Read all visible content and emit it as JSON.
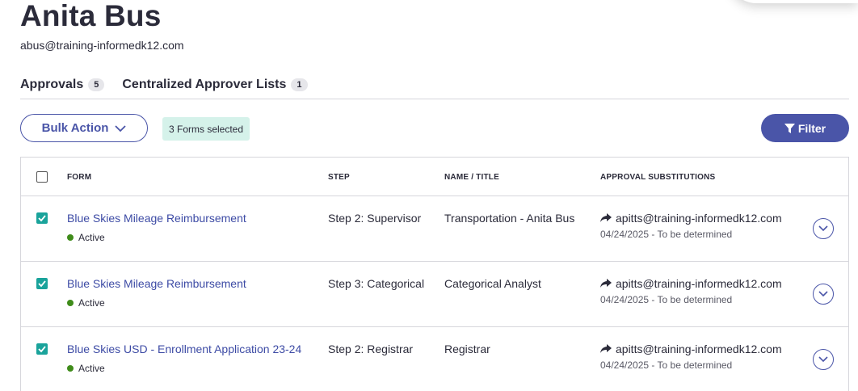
{
  "header": {
    "title": "Anita Bus",
    "email": "abus@training-informedk12.com"
  },
  "tabs": [
    {
      "label": "Approvals",
      "count": "5"
    },
    {
      "label": "Centralized Approver Lists",
      "count": "1"
    }
  ],
  "toolbar": {
    "bulk_action_label": "Bulk Action",
    "selected_label": "3 Forms selected",
    "filter_label": "Filter"
  },
  "table": {
    "columns": [
      "FORM",
      "STEP",
      "NAME / TITLE",
      "APPROVAL SUBSTITUTIONS"
    ],
    "rows": [
      {
        "form": "Blue Skies Mileage Reimbursement",
        "status": "Active",
        "step": "Step 2: Supervisor",
        "name": "Transportation - Anita Bus",
        "substitution": "apitts@training-informedk12.com",
        "sub_date": "04/24/2025 - To be determined",
        "checked": true
      },
      {
        "form": "Blue Skies Mileage Reimbursement",
        "status": "Active",
        "step": "Step 3: Categorical",
        "name": "Categorical Analyst",
        "substitution": "apitts@training-informedk12.com",
        "sub_date": "04/24/2025 - To be determined",
        "checked": true
      },
      {
        "form": "Blue Skies USD - Enrollment Application 23-24",
        "status": "Active",
        "step": "Step 2: Registrar",
        "name": "Registrar",
        "substitution": "apitts@training-informedk12.com",
        "sub_date": "04/24/2025 - To be determined",
        "checked": true
      }
    ]
  },
  "colors": {
    "accent": "#4a55a8",
    "checkbox": "#1aa39b",
    "status_active": "#3f8c1a",
    "selected_badge_bg": "#d5f2ea"
  },
  "icons": {
    "bulk_chevron": "chevron-down-icon",
    "filter": "filter-icon",
    "substitution": "forward-arrow-icon",
    "row_expand": "chevron-down-circle-icon"
  }
}
